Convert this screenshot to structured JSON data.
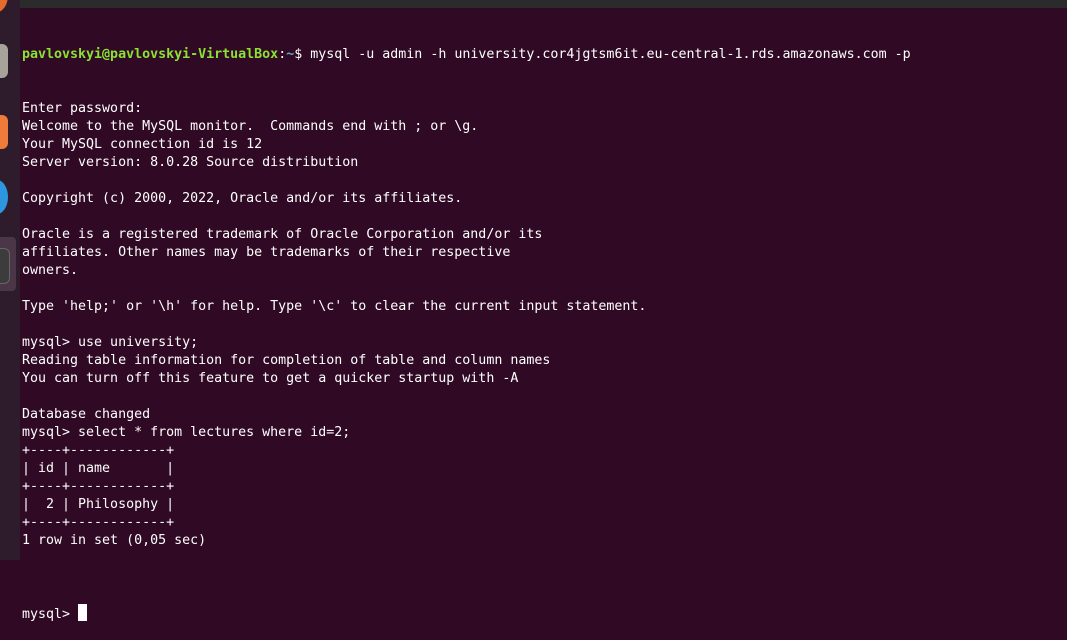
{
  "prompt": {
    "user_host": "pavlovskyi@pavlovskyi-VirtualBox",
    "sep": ":",
    "path": "~",
    "symbol": "$ ",
    "command": "mysql -u admin -h university.cor4jgtsm6it.eu-central-1.rds.amazonaws.com -p"
  },
  "lines": [
    "Enter password:",
    "Welcome to the MySQL monitor.  Commands end with ; or \\g.",
    "Your MySQL connection id is 12",
    "Server version: 8.0.28 Source distribution",
    "",
    "Copyright (c) 2000, 2022, Oracle and/or its affiliates.",
    "",
    "Oracle is a registered trademark of Oracle Corporation and/or its",
    "affiliates. Other names may be trademarks of their respective",
    "owners.",
    "",
    "Type 'help;' or '\\h' for help. Type '\\c' to clear the current input statement.",
    "",
    "mysql> use university;",
    "Reading table information for completion of table and column names",
    "You can turn off this feature to get a quicker startup with -A",
    "",
    "Database changed",
    "mysql> select * from lectures where id=2;",
    "+----+------------+",
    "| id | name       |",
    "+----+------------+",
    "|  2 | Philosophy |",
    "+----+------------+",
    "1 row in set (0,05 sec)",
    ""
  ],
  "final_prompt": "mysql> "
}
